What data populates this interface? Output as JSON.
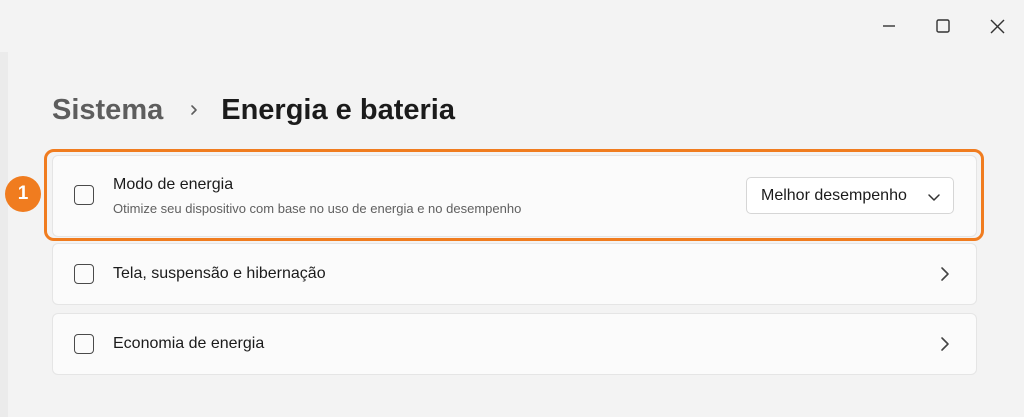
{
  "window": {
    "controls": {
      "minimize": "minimize-icon",
      "maximize": "maximize-icon",
      "close": "close-icon"
    }
  },
  "breadcrumb": {
    "parent": "Sistema",
    "separator_icon": "chevron-right-icon",
    "current": "Energia e bateria"
  },
  "annotation": {
    "step_number": "1",
    "color": "#f07c1f"
  },
  "settings": {
    "power_mode": {
      "title": "Modo de energia",
      "subtitle": "Otimize seu dispositivo com base no uso de energia e no desempenho",
      "selected_value": "Melhor desempenho",
      "icon": "checkbox-placeholder-icon"
    },
    "screen_sleep": {
      "title": "Tela, suspensão e hibernação",
      "icon": "checkbox-placeholder-icon"
    },
    "energy_saver": {
      "title": "Economia de energia",
      "icon": "checkbox-placeholder-icon"
    }
  }
}
